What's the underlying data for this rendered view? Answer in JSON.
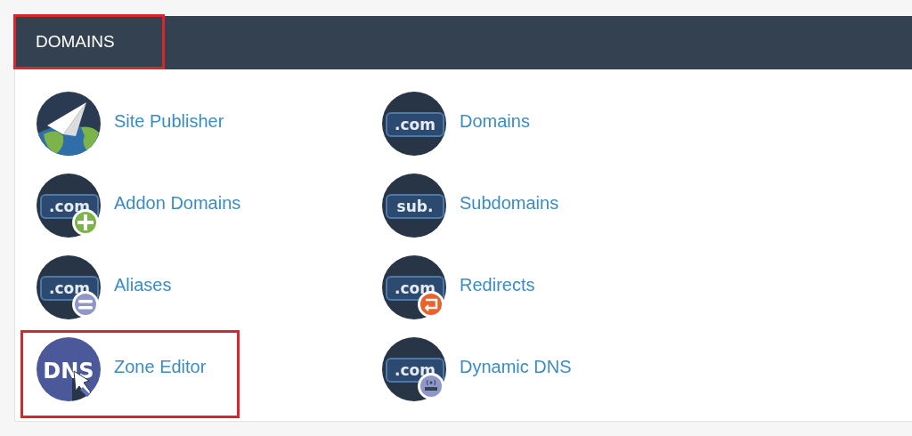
{
  "section": {
    "title": "DOMAINS",
    "highlighted": true
  },
  "items": [
    {
      "label": "Site Publisher",
      "icon": {
        "kind": "globe"
      },
      "highlighted": false
    },
    {
      "label": "Domains",
      "icon": {
        "kind": "tag",
        "text": ".com"
      },
      "highlighted": false
    },
    {
      "label": "Addon Domains",
      "icon": {
        "kind": "tag",
        "text": ".com",
        "badge": {
          "kind": "plus"
        }
      },
      "highlighted": false
    },
    {
      "label": "Subdomains",
      "icon": {
        "kind": "tag",
        "text": "sub."
      },
      "highlighted": false
    },
    {
      "label": "Aliases",
      "icon": {
        "kind": "tag",
        "text": ".com",
        "badge": {
          "kind": "equals"
        }
      },
      "highlighted": false
    },
    {
      "label": "Redirects",
      "icon": {
        "kind": "tag",
        "text": ".com",
        "badge": {
          "kind": "redirect"
        }
      },
      "highlighted": false
    },
    {
      "label": "Zone Editor",
      "icon": {
        "kind": "dns",
        "text": "DNS"
      },
      "highlighted": true
    },
    {
      "label": "Dynamic DNS",
      "icon": {
        "kind": "tag",
        "text": ".com",
        "badge": {
          "kind": "router"
        }
      },
      "highlighted": false
    }
  ]
}
